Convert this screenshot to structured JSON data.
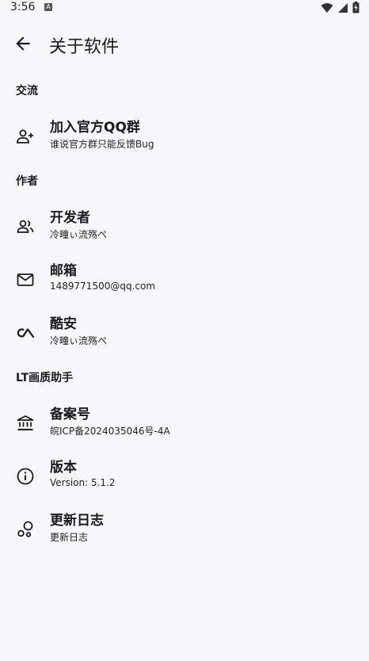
{
  "status": {
    "time": "3:56",
    "notif": "A"
  },
  "header": {
    "title": "关于软件"
  },
  "sections": [
    {
      "title": "交流",
      "items": [
        {
          "title": "加入官方QQ群",
          "subtitle": "谁说官方群只能反馈Bug",
          "icon": "person-add-icon"
        }
      ]
    },
    {
      "title": "作者",
      "items": [
        {
          "title": "开发者",
          "subtitle": "冷疃ぃ流殇ぺ",
          "icon": "people-icon"
        },
        {
          "title": "邮箱",
          "subtitle": "1489771500@qq.com",
          "icon": "mail-icon"
        },
        {
          "title": "酷安",
          "subtitle": "冷疃ぃ流殇ぺ",
          "icon": "coolapk-icon"
        }
      ]
    },
    {
      "title": "LT画质助手",
      "items": [
        {
          "title": "备案号",
          "subtitle": "皖ICP备2024035046号-4A",
          "icon": "bank-icon"
        },
        {
          "title": "版本",
          "subtitle": "Version: 5.1.2",
          "icon": "info-icon"
        },
        {
          "title": "更新日志",
          "subtitle": "更新日志",
          "icon": "bubbles-icon"
        }
      ]
    }
  ]
}
